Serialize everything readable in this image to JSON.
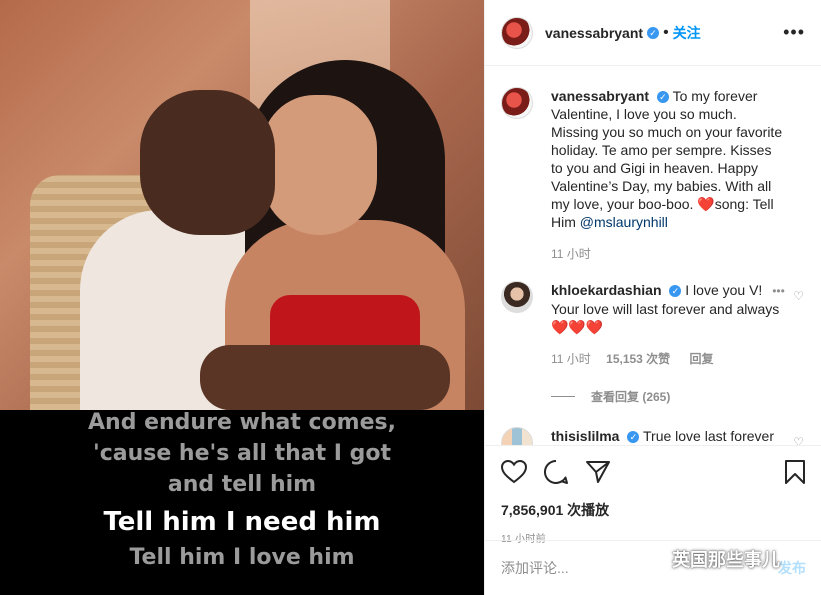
{
  "post": {
    "username": "vanessabryant",
    "follow_label": "关注",
    "more_label": "•••"
  },
  "lyrics": [
    "And endure what comes,",
    "'cause he's all that I got",
    "and tell him",
    "Tell him I need him",
    "Tell him I love him"
  ],
  "caption": {
    "username": "vanessabryant",
    "text": "To my forever Valentine, I love you so much. Missing you so much on your favorite holiday. Te amo per sempre. Kisses to you and Gigi in heaven. Happy Valentine’s Day, my babies. With all my love, your boo-boo. ❤️song: Tell Him ",
    "mention": "@mslaurynhill",
    "time": "11 小时"
  },
  "comments": [
    {
      "username": "khloekardashian",
      "text": "I love you V!",
      "text2": "Your love will last forever and always ❤️❤️❤️",
      "time": "11 小时",
      "likes": "15,153 次赞",
      "reply": "回复",
      "view_replies": "查看回复 (265)"
    },
    {
      "username": "thisislilma",
      "text": "True love last forever🖤"
    }
  ],
  "actions": {
    "views": "7,856,901 次播放",
    "timestamp": "11 小时前"
  },
  "add_comment": {
    "placeholder": "添加评论...",
    "post_label": "发布"
  },
  "watermark": "英国那些事儿",
  "colors": {
    "link": "#00376b",
    "accent": "#0095f6",
    "verified": "#3897f0"
  }
}
